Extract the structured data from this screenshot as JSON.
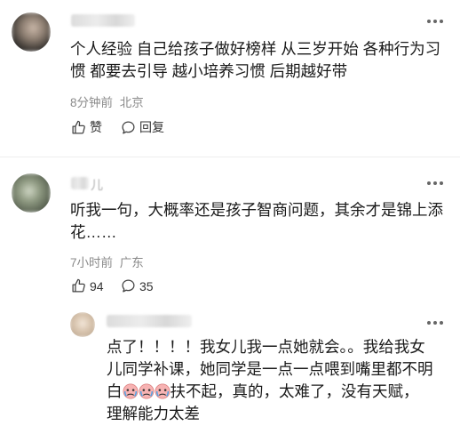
{
  "comments": [
    {
      "text_lines": [
        "个人经验 自己给孩子做好榜样 从三岁开始 各种行为习",
        "惯 都要去引导 越小培养习惯 后期越好带"
      ],
      "time": "8分钟前",
      "location": "北京",
      "like_label": "赞",
      "reply_label": "回复"
    },
    {
      "name_fragment": "儿",
      "text_lines": [
        "听我一句，大概率还是孩子智商问题，其余才是锦上添",
        "花……"
      ],
      "time": "7小时前",
      "location": "广东",
      "like_count": "94",
      "reply_count": "35"
    }
  ],
  "reply": {
    "line1": "点了！！！！我女儿我一点她就会。。我给我女",
    "line2": "儿同学补课，她同学是一点一点喂到嘴里都不明",
    "line3_after_emoji": "扶不起，真的，太难了，没有天赋，",
    "line3_before_emoji": "白",
    "line4": "理解能力太差",
    "emoji_name": "crying-emoji"
  },
  "icons": {
    "more": "more-icon",
    "like": "thumb-up-icon",
    "reply": "speech-bubble-icon"
  }
}
